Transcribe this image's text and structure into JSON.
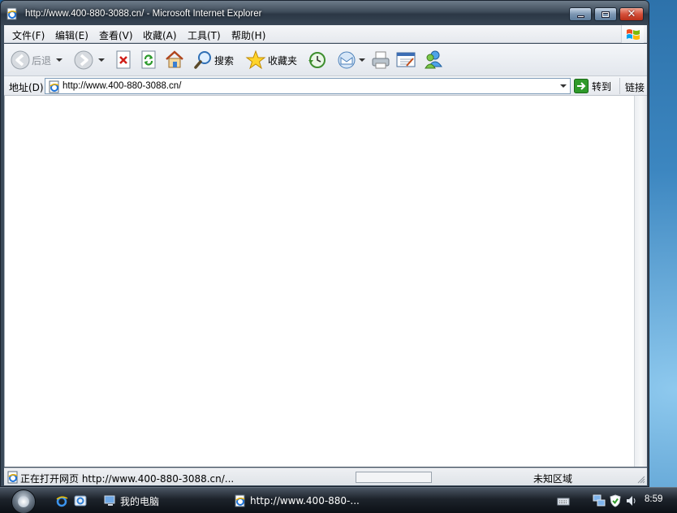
{
  "window": {
    "title": "http://www.400-880-3088.cn/ - Microsoft Internet Explorer"
  },
  "menu": {
    "items": [
      {
        "label": "文件(F)"
      },
      {
        "label": "编辑(E)"
      },
      {
        "label": "查看(V)"
      },
      {
        "label": "收藏(A)"
      },
      {
        "label": "工具(T)"
      },
      {
        "label": "帮助(H)"
      }
    ]
  },
  "toolbar": {
    "back_label": "后退",
    "search_label": "搜索",
    "favorites_label": "收藏夹"
  },
  "address": {
    "label": "地址(D)",
    "url": "http://www.400-880-3088.cn/",
    "go_label": "转到",
    "links_label": "链接"
  },
  "status": {
    "text": "正在打开网页 http://www.400-880-3088.cn/...",
    "progress": 0,
    "zone": "未知区域"
  },
  "taskbar": {
    "my_computer_label": "我的电脑",
    "ie_task_label": "http://www.400-880-...",
    "clock": "8:59"
  },
  "colors": {
    "titlebar": "#3f4c5a",
    "close_button": "#d5503a",
    "address_border": "#7f9db9"
  }
}
